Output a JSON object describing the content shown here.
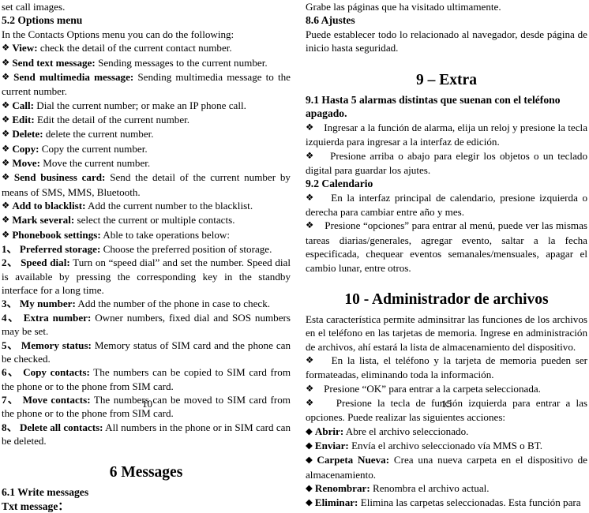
{
  "document": {
    "type": "mobile-phone-user-manual-spread",
    "left_page": {
      "page_number": "10",
      "language": "English",
      "blocks": [
        {
          "kind": "text",
          "text": "set call images."
        },
        {
          "kind": "heading2",
          "text": "5.2 Options menu"
        },
        {
          "kind": "text",
          "text": "In the Contacts Options menu you can do the following:"
        },
        {
          "kind": "bullet-open",
          "label": "View:",
          "text": "check the detail of the current contact number."
        },
        {
          "kind": "bullet-open",
          "label": "Send text message:",
          "text": "Sending messages to the current number."
        },
        {
          "kind": "bullet-open",
          "label": "Send multimedia message:",
          "text": "Sending multimedia message to the current number."
        },
        {
          "kind": "bullet-open",
          "label": "Call:",
          "text": "Dial the current number; or make an IP phone call."
        },
        {
          "kind": "bullet-open",
          "label": "Edit:",
          "text": "Edit the detail of the current number."
        },
        {
          "kind": "bullet-open",
          "label": "Delete:",
          "text": "delete the current number."
        },
        {
          "kind": "bullet-open",
          "label": "Copy:",
          "text": "Copy the current number."
        },
        {
          "kind": "bullet-open",
          "label": "Move:",
          "text": "Move the current number."
        },
        {
          "kind": "bullet-open",
          "label": "Send business card:",
          "text": "Send the detail of the current number by means of SMS, MMS, Bluetooth."
        },
        {
          "kind": "bullet-open",
          "label": "Add to blacklist:",
          "text": "Add the current number to the blacklist."
        },
        {
          "kind": "bullet-open",
          "label": "Mark several:",
          "text": "select the current or multiple contacts."
        },
        {
          "kind": "bullet-open",
          "label": "Phonebook settings:",
          "text": "Able to take operations below:"
        },
        {
          "kind": "numbered",
          "number": "1、",
          "label": "Preferred storage:",
          "text": "Choose the preferred position of storage."
        },
        {
          "kind": "numbered",
          "number": "2、",
          "label": "Speed dial:",
          "text": "Turn on “speed dial” and set the number. Speed dial is available by pressing the corresponding key in the standby interface for a long time."
        },
        {
          "kind": "numbered",
          "number": "3、",
          "label": "My number:",
          "text": "Add the number of the phone in case to check."
        },
        {
          "kind": "numbered",
          "number": "4、",
          "label": "Extra number:",
          "text": "Owner numbers, fixed dial and SOS numbers may be set."
        },
        {
          "kind": "numbered",
          "number": "5、",
          "label": "Memory status:",
          "text": "Memory status of SIM card and the phone can be checked."
        },
        {
          "kind": "numbered",
          "number": "6、",
          "label": "Copy contacts:",
          "text": "The numbers can be copied to SIM   card from the phone or to the phone from SIM card."
        },
        {
          "kind": "numbered",
          "number": "7、",
          "label": "Move contacts:",
          "text": "The numbers can be moved to SIM   card from the phone or to the phone from SIM card."
        },
        {
          "kind": "numbered",
          "number": "8、",
          "label": "Delete all contacts:",
          "text": "All numbers in the phone or in SIM card can be deleted."
        },
        {
          "kind": "chapter",
          "text": "6 Messages"
        },
        {
          "kind": "heading2",
          "text": "6.1 Write messages"
        },
        {
          "kind": "heading2",
          "text": "Txt message："
        }
      ]
    },
    "right_page": {
      "page_number": "15",
      "language": "Spanish",
      "blocks": [
        {
          "kind": "text",
          "text": "Grabe las páginas que ha visitado ultimamente."
        },
        {
          "kind": "heading2",
          "text": "8.6 Ajustes"
        },
        {
          "kind": "text",
          "text": "Puede establecer todo lo relacionado al navegador, desde página de inicio hasta seguridad."
        },
        {
          "kind": "chapter",
          "text": "9 – Extra"
        },
        {
          "kind": "heading2",
          "text": "9.1 Hasta 5 alarmas distintas que suenan con el teléfono apagado."
        },
        {
          "kind": "bullet-open",
          "label": "",
          "text": "Ingresar a la función de alarma, elija un reloj y presione la tecla izquierda para ingresar a la interfaz de edición."
        },
        {
          "kind": "bullet-open",
          "label": "",
          "text": "Presione arriba o abajo para elegir los objetos o un teclado digital para guardar los ajutes."
        },
        {
          "kind": "heading2",
          "text": "9.2 Calendario"
        },
        {
          "kind": "bullet-open",
          "label": "",
          "text": "En la interfaz principal de calendario, presione izquierda o derecha para cambiar entre año y mes."
        },
        {
          "kind": "bullet-open",
          "label": "",
          "text": "Presione “opciones” para entrar al menú, puede ver las mismas tareas diarias/generales, agregar evento, saltar a la fecha especificada, chequear eventos semanales/mensuales, apagar el cambio lunar, entre otros."
        },
        {
          "kind": "chapter",
          "text": "10 - Administrador de archivos"
        },
        {
          "kind": "text",
          "text": "Esta característica permite adminsitrar las funciones de los archivos en el teléfono en las tarjetas de memoria. Ingrese en administración de archivos, ahí estará la lista de almacenamiento del dispositivo."
        },
        {
          "kind": "bullet-open",
          "label": "",
          "text": "En la lista, el teléfono y la tarjeta de memoria pueden ser formateadas, eliminando toda la información."
        },
        {
          "kind": "bullet-open",
          "label": "",
          "text": "Presione “OK” para entrar a la carpeta seleccionada."
        },
        {
          "kind": "bullet-open",
          "label": "",
          "text": "Presione la tecla de función izquierda para entrar a las opciones. Puede realizar las siguientes acciones:"
        },
        {
          "kind": "bullet-solid",
          "label": "Abrir:",
          "text": "Abre el archivo seleccionado."
        },
        {
          "kind": "bullet-solid",
          "label": "Enviar:",
          "text": "Envía el archivo seleccionado vía MMS o BT."
        },
        {
          "kind": "bullet-solid",
          "label": "Carpeta Nueva:",
          "text": "Crea una nueva carpeta en el dispositivo de almacenamiento."
        },
        {
          "kind": "bullet-solid",
          "label": "Renombrar:",
          "text": "Renombra el archivo actual."
        },
        {
          "kind": "bullet-solid",
          "label": "Eliminar:",
          "text": "Elimina las carpetas seleccionadas.   Esta función para"
        }
      ]
    }
  }
}
